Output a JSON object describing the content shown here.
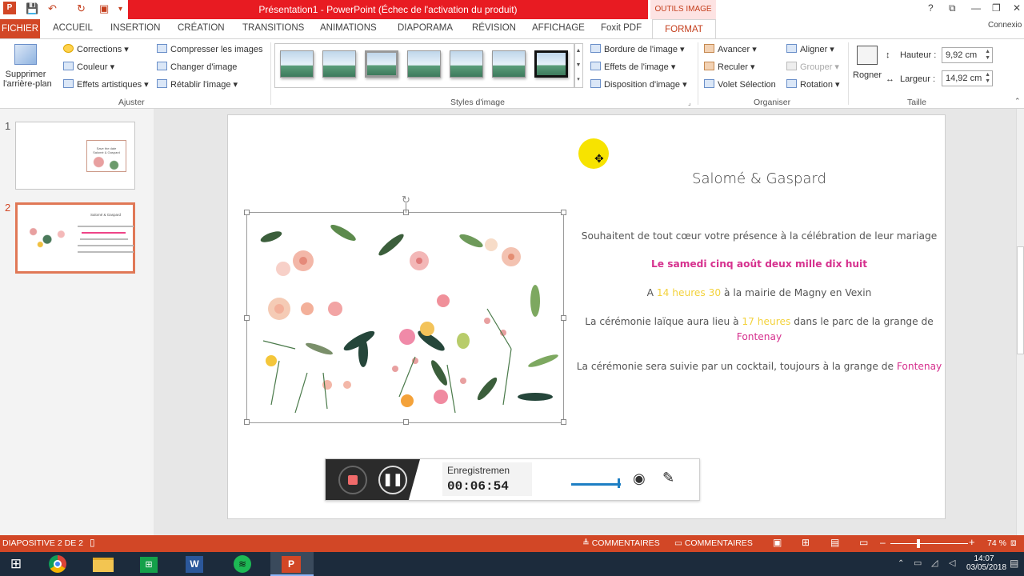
{
  "window": {
    "title": "Présentation1 - PowerPoint (Échec de l'activation du produit)",
    "context_tab": "OUTILS IMAGE",
    "help": "?",
    "account": "Connexio"
  },
  "tabs": [
    "FICHIER",
    "ACCUEIL",
    "INSERTION",
    "CRÉATION",
    "TRANSITIONS",
    "ANIMATIONS",
    "DIAPORAMA",
    "RÉVISION",
    "AFFICHAGE",
    "Foxit PDF",
    "FORMAT"
  ],
  "ribbon": {
    "remove_bg": [
      "Supprimer",
      "l'arrière-plan"
    ],
    "corrections": "Corrections",
    "couleur": "Couleur",
    "effets_artistiques": "Effets artistiques",
    "compresser": "Compresser les images",
    "changer": "Changer d'image",
    "retablir": "Rétablir l'image",
    "group_ajuster": "Ajuster",
    "group_styles": "Styles d'image",
    "bordure": "Bordure de l'image",
    "effets_image": "Effets de l'image",
    "disposition": "Disposition d'image",
    "avancer": "Avancer",
    "reculer": "Reculer",
    "volet": "Volet Sélection",
    "aligner": "Aligner",
    "grouper": "Grouper",
    "rotation": "Rotation",
    "group_organiser": "Organiser",
    "rogner": "Rogner",
    "hauteur_label": "Hauteur :",
    "hauteur_value": "9,92 cm",
    "largeur_label": "Largeur :",
    "largeur_value": "14,92 cm",
    "group_taille": "Taille"
  },
  "slides_pane": {
    "numbers": [
      "1",
      "2"
    ],
    "thumb1_text": [
      "Save the date",
      "Salomé & Gaspard"
    ],
    "thumb2_title": "Salomé & Gaspard"
  },
  "slide": {
    "title": "Salomé & Gaspard",
    "line1": "Souhaitent de tout cœur votre présence à la célébration de leur mariage",
    "line2": "Le samedi cinq août deux mille dix huit",
    "line3_a": "A ",
    "line3_b": "14 heures 30",
    "line3_c": " à la mairie de Magny en Vexin",
    "line4_a": "La cérémonie laïque aura lieu à ",
    "line4_b": "17 heures",
    "line4_c": " dans le parc de la grange de",
    "line4_d": "Fontenay",
    "line5_a": "La cérémonie sera suivie par un cocktail, toujours à la grange de ",
    "line5_b": "Fontenay"
  },
  "recorder": {
    "label": "Enregistremen",
    "time": "00:06:54"
  },
  "statusbar": {
    "slide_info": "DIAPOSITIVE 2 DE 2",
    "notes": "COMMENTAIRES",
    "comments": "COMMENTAIRES",
    "zoom": "74 %"
  },
  "taskbar": {
    "time": "14:07",
    "date": "03/05/2018"
  },
  "colors": {
    "accent": "#d24726",
    "title_red": "#e81b22",
    "pink": "#d6318e",
    "yellow": "#f3d23c",
    "cursor_highlight": "#f7e300"
  }
}
